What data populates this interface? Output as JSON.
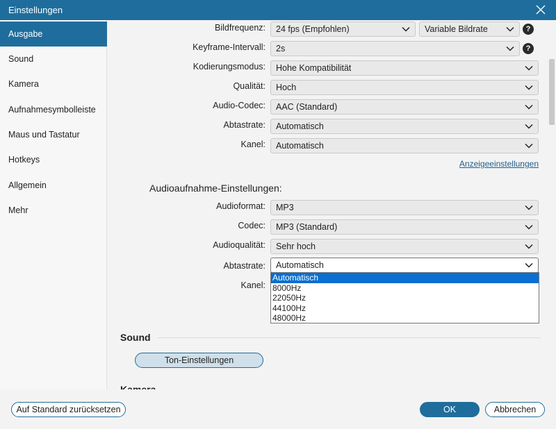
{
  "window": {
    "title": "Einstellungen"
  },
  "sidebar": {
    "items": [
      {
        "label": "Ausgabe",
        "active": true
      },
      {
        "label": "Sound"
      },
      {
        "label": "Kamera"
      },
      {
        "label": "Aufnahmesymbolleiste"
      },
      {
        "label": "Maus und Tastatur"
      },
      {
        "label": "Hotkeys"
      },
      {
        "label": "Allgemein"
      },
      {
        "label": "Mehr"
      }
    ]
  },
  "video": {
    "framerate": {
      "label": "Bildfrequenz:",
      "value": "24 fps (Empfohlen)",
      "mode": "Variable Bildrate"
    },
    "keyframe": {
      "label": "Keyframe-Intervall:",
      "value": "2s"
    },
    "encoding": {
      "label": "Kodierungsmodus:",
      "value": "Hohe Kompatibilität"
    },
    "quality": {
      "label": "Qualität:",
      "value": "Hoch"
    },
    "audio_codec": {
      "label": "Audio-Codec:",
      "value": "AAC (Standard)"
    },
    "sample_rate": {
      "label": "Abtastrate:",
      "value": "Automatisch"
    },
    "channel": {
      "label": "Kanel:",
      "value": "Automatisch"
    },
    "display_link": "Anzeigeeinstellungen",
    "help_glyph": "?"
  },
  "audio_recording": {
    "heading": "Audioaufnahme-Einstellungen:",
    "format": {
      "label": "Audioformat:",
      "value": "MP3"
    },
    "codec": {
      "label": "Codec:",
      "value": "MP3 (Standard)"
    },
    "quality": {
      "label": "Audioqualität:",
      "value": "Sehr hoch"
    },
    "sample_rate": {
      "label": "Abtastrate:",
      "value": "Automatisch",
      "options": [
        "Automatisch",
        "8000Hz",
        "22050Hz",
        "44100Hz",
        "48000Hz"
      ]
    },
    "channel": {
      "label": "Kanel:"
    }
  },
  "sound_section": {
    "heading": "Sound",
    "button": "Ton-Einstellungen"
  },
  "camera_section": {
    "heading": "Kamera"
  },
  "footer": {
    "reset": "Auf Standard zurücksetzen",
    "ok": "OK",
    "cancel": "Abbrechen"
  },
  "colors": {
    "accent": "#1f6d9c",
    "selection": "#0a6fd1"
  }
}
